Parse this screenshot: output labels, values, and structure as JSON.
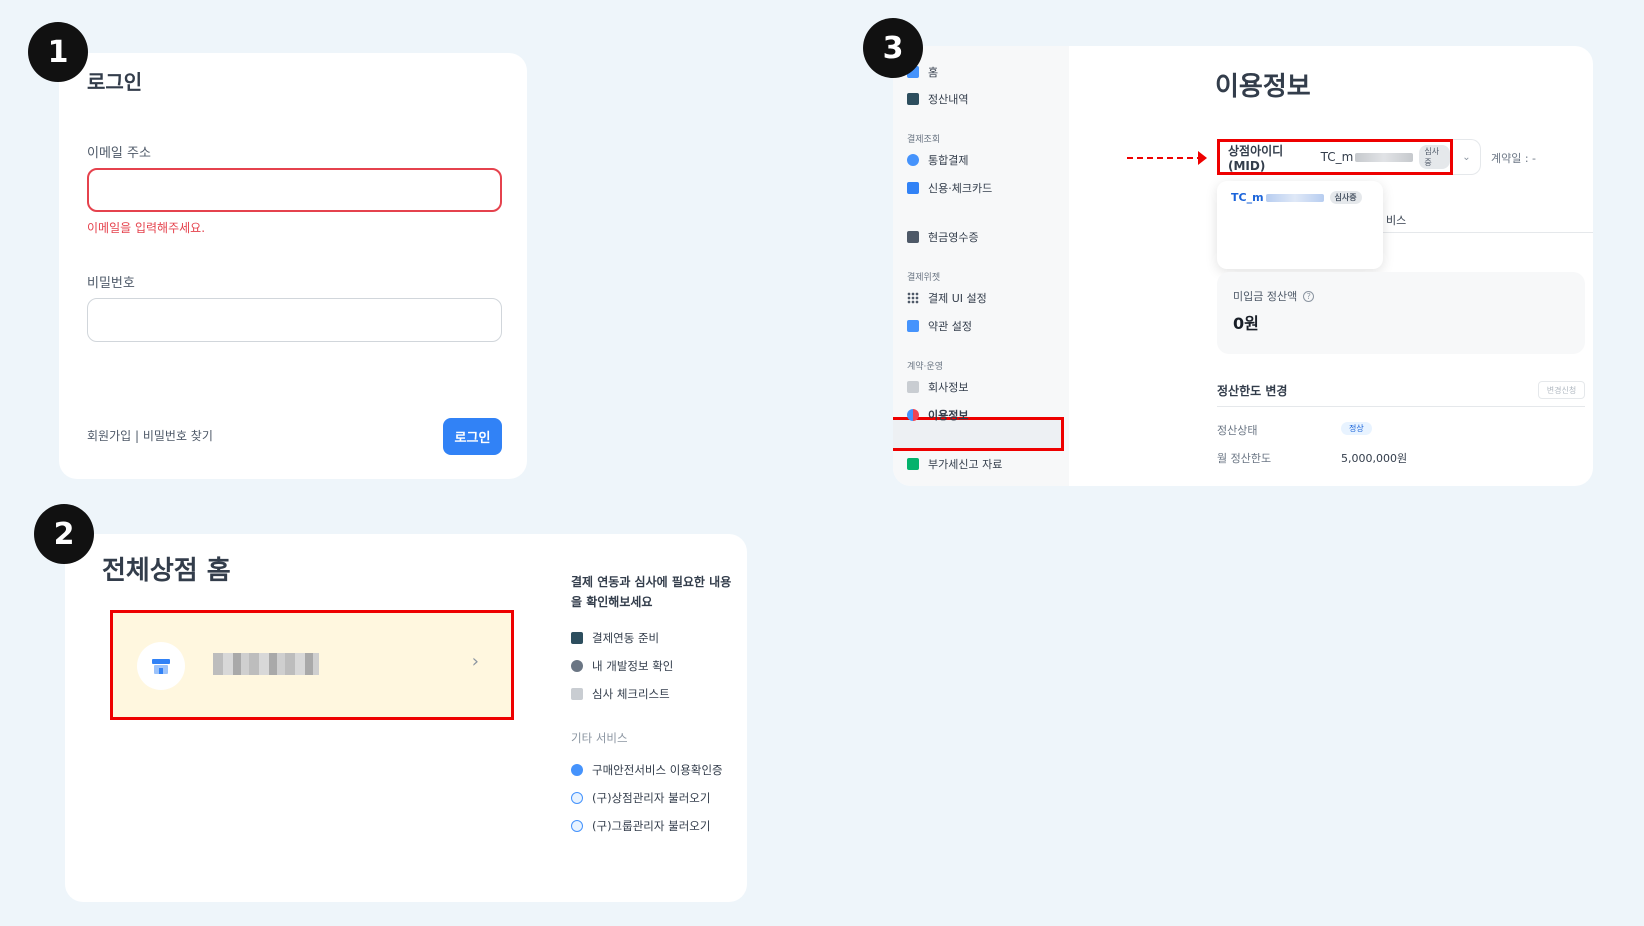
{
  "steps": [
    "1",
    "2",
    "3"
  ],
  "login": {
    "title": "로그인",
    "email_label": "이메일 주소",
    "email_value": "",
    "email_error": "이메일을 입력해주세요.",
    "password_label": "비밀번호",
    "password_value": "",
    "links": "회원가입 | 비밀번호 찾기",
    "login_button": "로그인"
  },
  "merchant_home": {
    "title": "전체상점 홈",
    "store_chevron": "›",
    "side_heading": "결제 연동과 심사에 필요한 내용을 확인해보세요",
    "side_items": [
      "결제연동 준비",
      "내 개발정보 확인",
      "심사 체크리스트"
    ],
    "other_heading": "기타 서비스",
    "other_items": [
      "구매안전서비스 이용확인증",
      "(구)상점관리자 불러오기",
      "(구)그룹관리자 불러오기"
    ]
  },
  "usage": {
    "nav": {
      "home": "홈",
      "settlement": "정산내역",
      "group_payment": "결제조회",
      "integrated": "통합결제",
      "card": "신용·체크카드",
      "cash_receipt": "현금영수증",
      "group_widget": "결제위젯",
      "payment_ui": "결제 UI 설정",
      "terms": "약관 설정",
      "group_contract": "계약·운영",
      "company": "회사정보",
      "usage_info": "이용정보",
      "vat": "부가세신고 자료"
    },
    "title": "이용정보",
    "mid_label": "상점아이디(MID)",
    "mid_value": "TC_m",
    "mid_tag": "심사중",
    "mid_arrow": "⌄",
    "contract": "계약일 : -",
    "dropdown_option": "TC_m",
    "dropdown_tag": "심사중",
    "tab_fragment": "비스",
    "unpaid_label": "미입금 정산액",
    "unpaid_help": "?",
    "unpaid_amount": "0원",
    "limit_title": "정산한도 변경",
    "limit_button": "변경신청",
    "status_label": "정산상태",
    "status_value": "정상",
    "monthly_label": "월 정산한도",
    "monthly_value": "5,000,000원"
  }
}
